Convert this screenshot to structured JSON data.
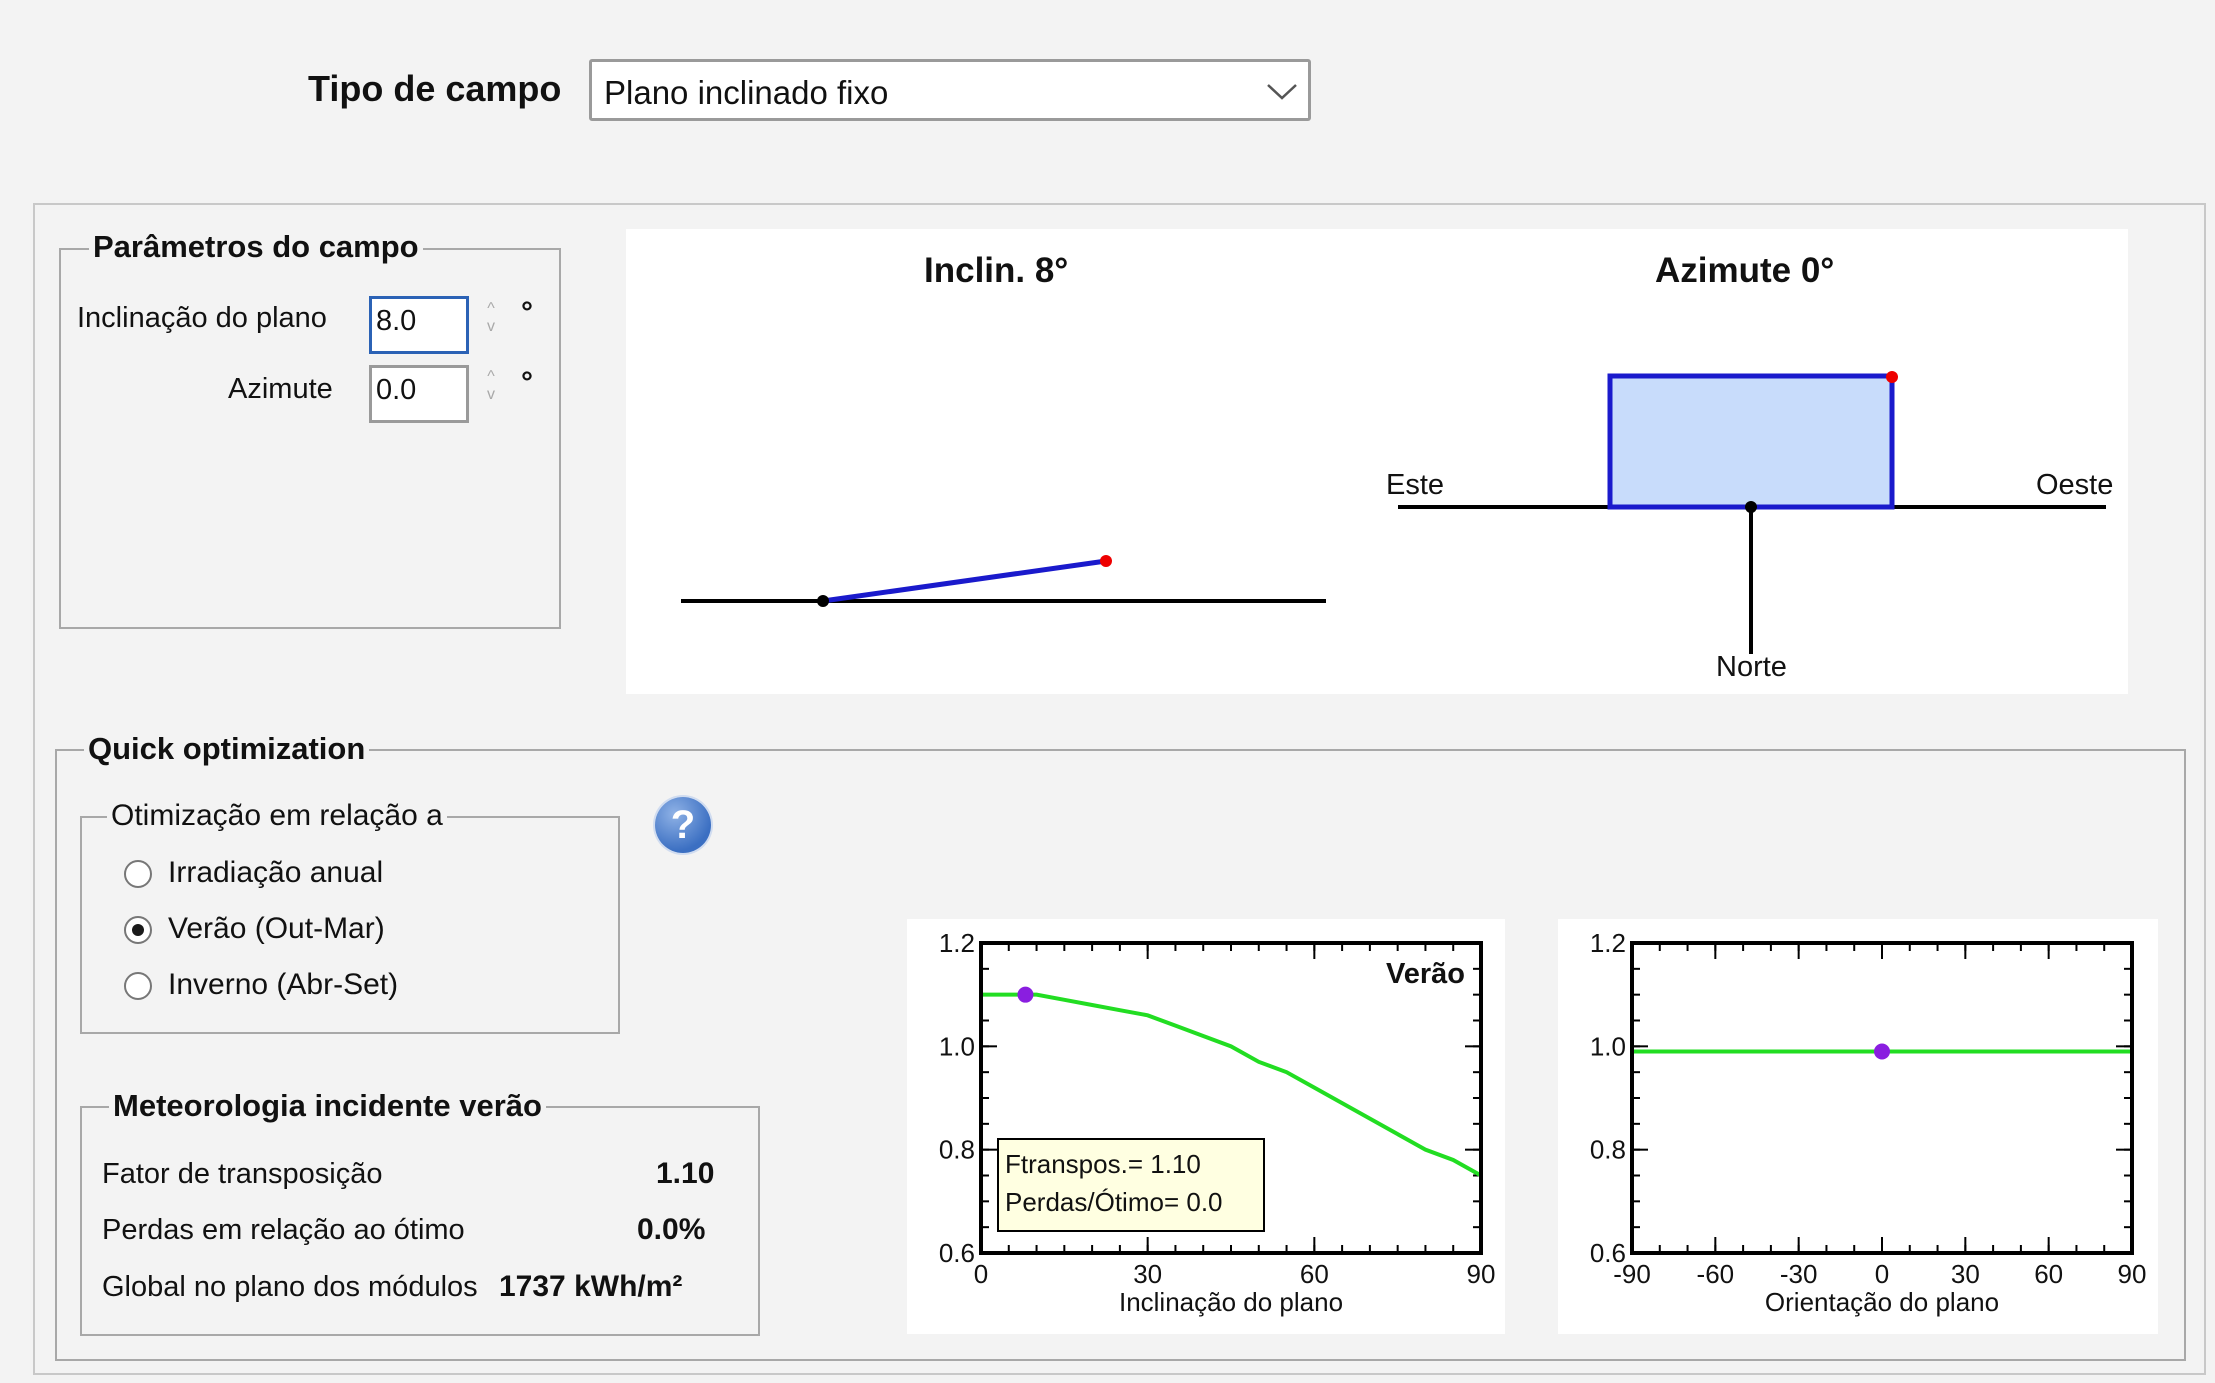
{
  "field_type": {
    "label": "Tipo de campo",
    "value": "Plano inclinado fixo"
  },
  "params": {
    "title": "Parâmetros do campo",
    "tilt_label": "Inclinação do plano",
    "tilt_value": "8.0",
    "azimuth_label": "Azimute",
    "azimuth_value": "0.0",
    "unit": "°"
  },
  "diagram": {
    "tilt_title": "Inclin. 8°",
    "azimuth_title": "Azimute 0°",
    "east": "Este",
    "west": "Oeste",
    "north": "Norte"
  },
  "quick_opt": {
    "title": "Quick optimization",
    "opt_group_title": "Otimização em relação a",
    "options": [
      "Irradiação anual",
      "Verão (Out-Mar)",
      "Inverno (Abr-Set)"
    ],
    "selected_index": 1,
    "help_icon": "question-icon"
  },
  "meteo": {
    "title": "Meteorologia incidente verão",
    "rows": [
      {
        "label": "Fator de transposição",
        "value": "1.10"
      },
      {
        "label": "Perdas em relação ao ótimo",
        "value": "0.0%"
      },
      {
        "label": "Global no plano dos módulos",
        "value": "1737 kWh/m²"
      }
    ]
  },
  "chart_data": [
    {
      "type": "line",
      "title": "Verão",
      "xlabel": "Inclinação do plano",
      "ylabel": "",
      "xlim": [
        0,
        90
      ],
      "ylim": [
        0.6,
        1.2
      ],
      "xticks": [
        0,
        30,
        60,
        90
      ],
      "yticks": [
        0.6,
        0.8,
        1.0,
        1.2
      ],
      "series": [
        {
          "x": [
            0,
            5,
            10,
            15,
            20,
            25,
            30,
            35,
            40,
            45,
            50,
            55,
            60,
            65,
            70,
            75,
            80,
            85,
            90
          ],
          "y": [
            1.1,
            1.1,
            1.1,
            1.09,
            1.08,
            1.07,
            1.06,
            1.04,
            1.02,
            1.0,
            0.97,
            0.95,
            0.92,
            0.89,
            0.86,
            0.83,
            0.8,
            0.78,
            0.75
          ]
        }
      ],
      "marker": {
        "x": 8,
        "y": 1.1
      },
      "annotation": [
        "Ftranspos.= 1.10",
        "Perdas/Ótimo= 0.0"
      ],
      "line_color": "#22dd22",
      "marker_color": "#8a1ee0"
    },
    {
      "type": "line",
      "title": "",
      "xlabel": "Orientação do plano",
      "ylabel": "",
      "xlim": [
        -90,
        90
      ],
      "ylim": [
        0.6,
        1.2
      ],
      "xticks": [
        -90,
        -60,
        -30,
        0,
        30,
        60,
        90
      ],
      "yticks": [
        0.6,
        0.8,
        1.0,
        1.2
      ],
      "series": [
        {
          "x": [
            -90,
            -60,
            -30,
            0,
            30,
            60,
            90
          ],
          "y": [
            0.99,
            0.99,
            0.99,
            0.99,
            0.99,
            0.99,
            0.99
          ]
        }
      ],
      "marker": {
        "x": 0,
        "y": 0.99
      },
      "line_color": "#22dd22",
      "marker_color": "#8a1ee0"
    }
  ]
}
